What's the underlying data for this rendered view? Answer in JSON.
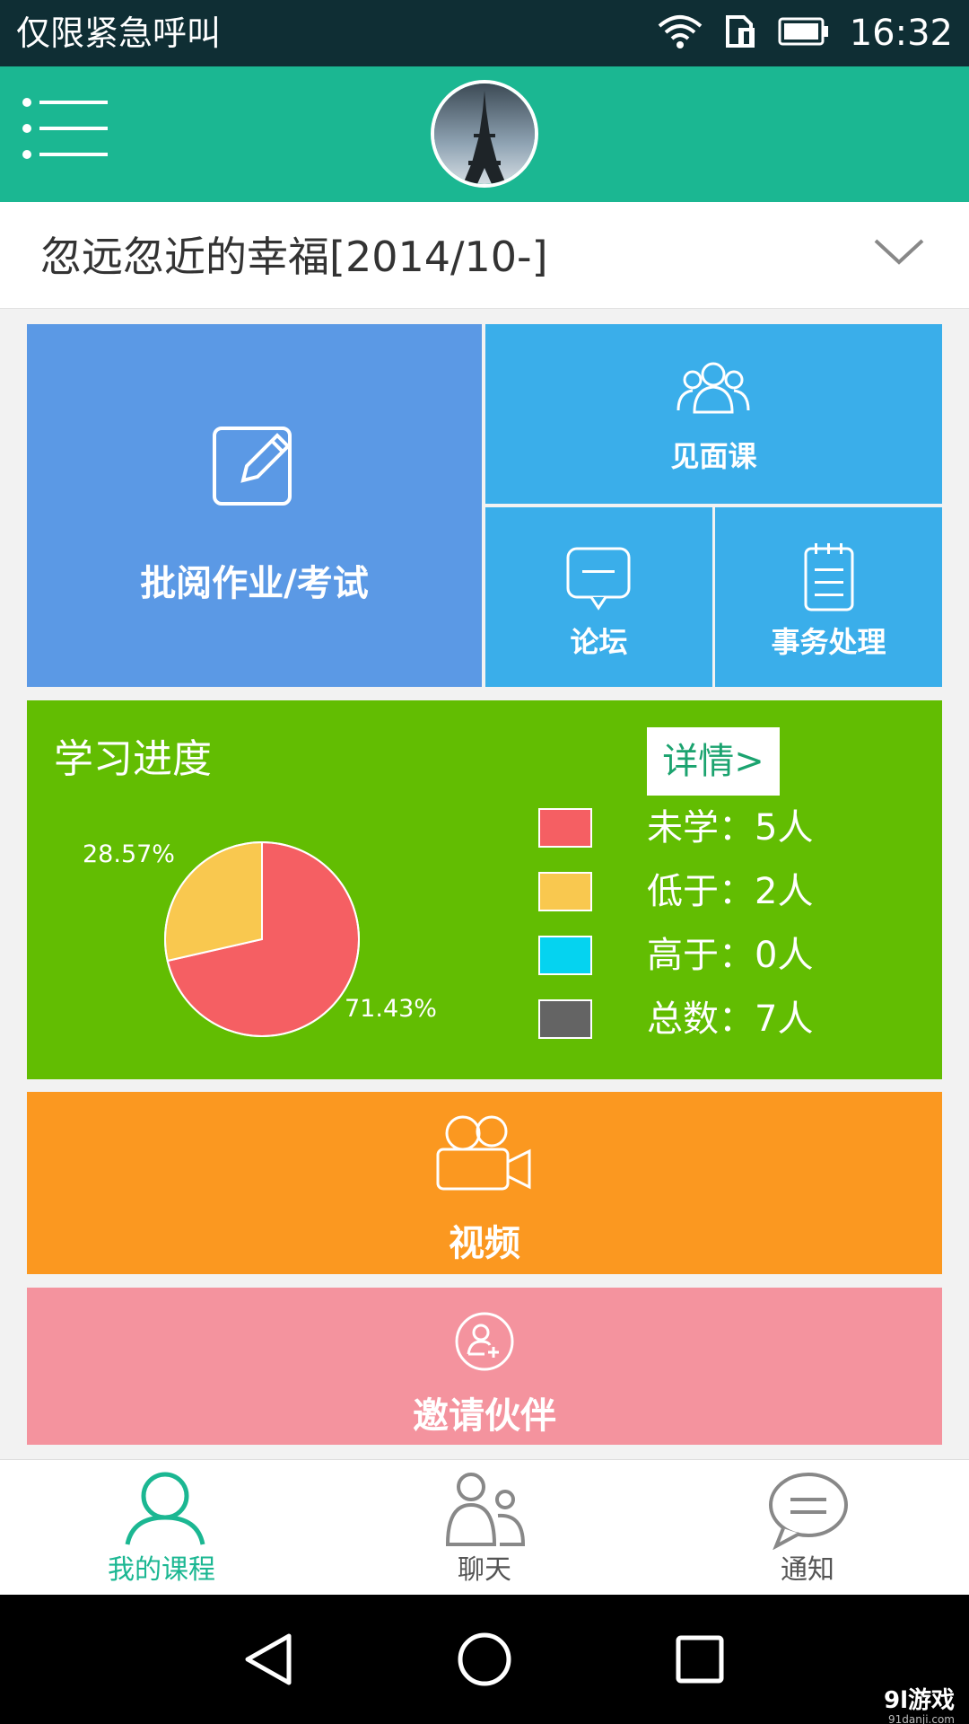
{
  "status_bar": {
    "carrier": "仅限紧急呼叫",
    "time": "16:32",
    "icons": [
      "wifi-icon",
      "sim-icon",
      "battery-icon"
    ]
  },
  "header": {
    "menu_icon": "menu-icon",
    "avatar": "eiffel-tower-avatar"
  },
  "course": {
    "title": "忽远忽近的幸福[2014/10-]",
    "chevron_icon": "chevron-down-icon"
  },
  "tiles": {
    "grade": {
      "label": "批阅作业/考试",
      "icon": "edit-icon",
      "color": "#5b99e5"
    },
    "meet": {
      "label": "见面课",
      "icon": "group-icon",
      "color": "#3aaeea"
    },
    "forum": {
      "label": "论坛",
      "icon": "chat-bubble-icon",
      "color": "#3aaeea"
    },
    "affairs": {
      "label": "事务处理",
      "icon": "notepad-icon",
      "color": "#3aaeea"
    },
    "video": {
      "label": "视频",
      "icon": "video-camera-icon",
      "color": "#fb9820"
    },
    "invite": {
      "label": "邀请伙伴",
      "icon": "add-user-icon",
      "color": "#f4939e"
    }
  },
  "progress": {
    "title": "学习进度",
    "details_label": "详情>",
    "legend": [
      {
        "label": "未学：5人",
        "color": "#f55f63"
      },
      {
        "label": "低于：2人",
        "color": "#f9c84f"
      },
      {
        "label": "高于：0人",
        "color": "#05d3f0"
      },
      {
        "label": "总数：7人",
        "color": "#646464"
      }
    ]
  },
  "chart_data": {
    "type": "pie",
    "categories": [
      "未学",
      "低于"
    ],
    "values": [
      71.43,
      28.57
    ],
    "labels": [
      "71.43%",
      "28.57%"
    ],
    "colors": [
      "#f55f63",
      "#f9c84f"
    ]
  },
  "bottom_nav": {
    "items": [
      {
        "label": "我的课程",
        "icon": "person-icon",
        "active": true
      },
      {
        "label": "聊天",
        "icon": "people-icon",
        "active": false
      },
      {
        "label": "通知",
        "icon": "speech-bubble-icon",
        "active": false
      }
    ],
    "active_color": "#1bb792",
    "inactive_color": "#555555"
  },
  "system_bar": {
    "buttons": [
      "back-icon",
      "home-icon",
      "recents-icon"
    ]
  },
  "watermark": {
    "main": "9l游戏",
    "sub": "91danji.com"
  }
}
